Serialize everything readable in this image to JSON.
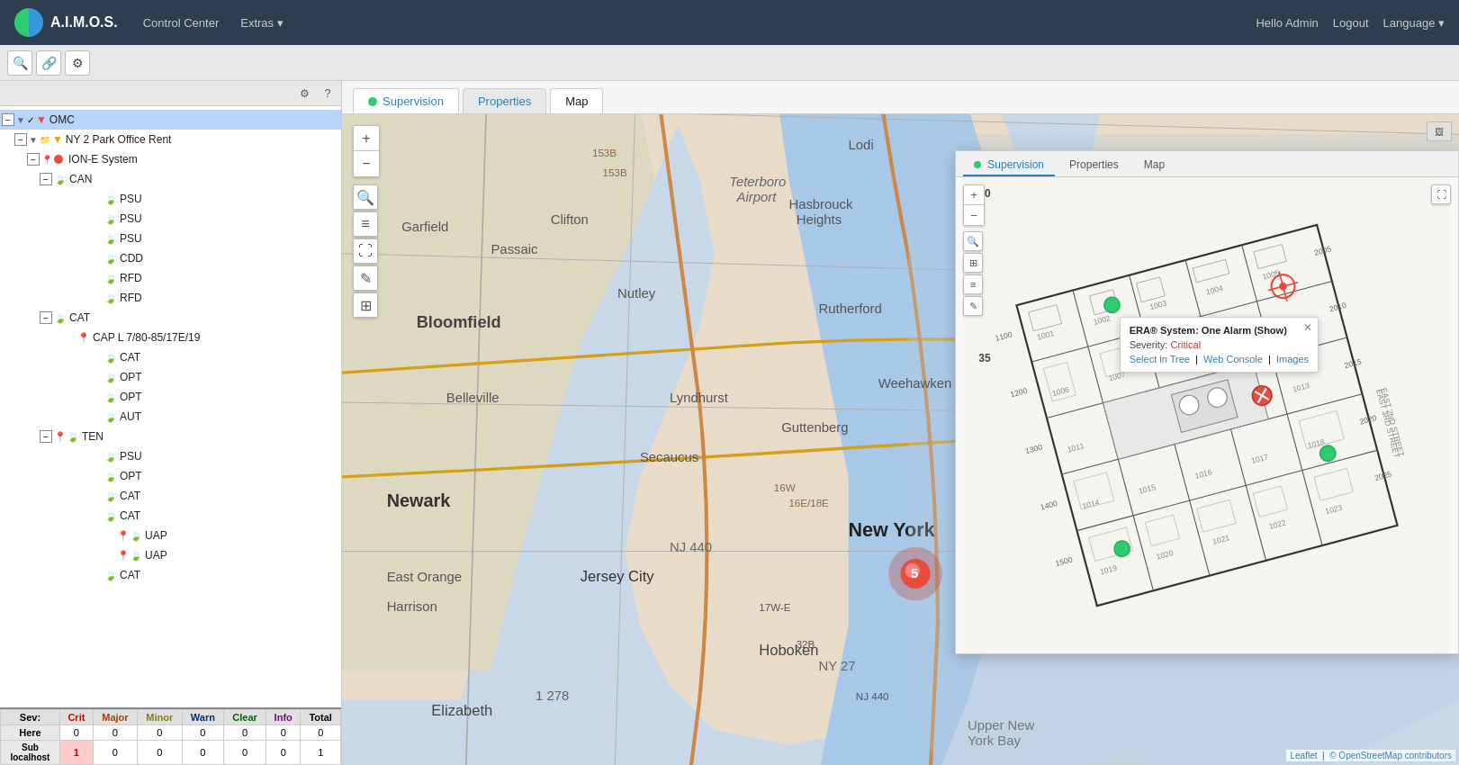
{
  "app": {
    "logo": "A.I.M.O.S.",
    "nav": {
      "control_center": "Control Center",
      "extras": "Extras ▾",
      "hello": "Hello Admin",
      "logout": "Logout",
      "language": "Language ▾"
    }
  },
  "toolbar": {
    "search_icon": "🔍",
    "link_icon": "🔗",
    "settings_icon": "⚙"
  },
  "tree": {
    "panel_buttons": [
      "⚙",
      "?"
    ],
    "items": [
      {
        "id": "omc",
        "label": "OMC",
        "level": 0,
        "expanded": true,
        "selected": false,
        "icon": "folder",
        "color": "red"
      },
      {
        "id": "ny2",
        "label": "NY 2 Park Office Rent",
        "level": 1,
        "expanded": true,
        "icon": "folder",
        "color": "yellow"
      },
      {
        "id": "ione",
        "label": "ION-E System",
        "level": 2,
        "expanded": true,
        "icon": "dot-red"
      },
      {
        "id": "can",
        "label": "CAN",
        "level": 3,
        "expanded": true,
        "icon": "leaf"
      },
      {
        "id": "psu1",
        "label": "PSU",
        "level": 4,
        "icon": "leaf"
      },
      {
        "id": "psu2",
        "label": "PSU",
        "level": 4,
        "icon": "leaf"
      },
      {
        "id": "psu3",
        "label": "PSU",
        "level": 4,
        "icon": "leaf"
      },
      {
        "id": "cdd",
        "label": "CDD",
        "level": 4,
        "icon": "leaf"
      },
      {
        "id": "rfd1",
        "label": "RFD",
        "level": 4,
        "icon": "leaf"
      },
      {
        "id": "rfd2",
        "label": "RFD",
        "level": 4,
        "icon": "leaf"
      },
      {
        "id": "cat1",
        "label": "CAT",
        "level": 3,
        "expanded": true,
        "icon": "leaf"
      },
      {
        "id": "capl",
        "label": "CAP L 7/80-85/17E/19",
        "level": 4,
        "icon": "location"
      },
      {
        "id": "cat2",
        "label": "CAT",
        "level": 4,
        "icon": "leaf"
      },
      {
        "id": "opt1",
        "label": "OPT",
        "level": 4,
        "icon": "leaf"
      },
      {
        "id": "opt2",
        "label": "OPT",
        "level": 4,
        "icon": "leaf"
      },
      {
        "id": "aut",
        "label": "AUT",
        "level": 4,
        "icon": "leaf"
      },
      {
        "id": "ten",
        "label": "TEN",
        "level": 3,
        "expanded": true,
        "icon": "leaf"
      },
      {
        "id": "psu4",
        "label": "PSU",
        "level": 4,
        "icon": "leaf"
      },
      {
        "id": "opt3",
        "label": "OPT",
        "level": 4,
        "icon": "leaf"
      },
      {
        "id": "cat3",
        "label": "CAT",
        "level": 4,
        "icon": "leaf"
      },
      {
        "id": "cat4",
        "label": "CAT",
        "level": 4,
        "icon": "leaf"
      },
      {
        "id": "uap1",
        "label": "UAP",
        "level": 5,
        "icon": "location"
      },
      {
        "id": "uap2",
        "label": "UAP",
        "level": 5,
        "icon": "location"
      },
      {
        "id": "cat5",
        "label": "CAT",
        "level": 4,
        "icon": "leaf"
      }
    ]
  },
  "tabs": {
    "supervision": "Supervision",
    "properties": "Properties",
    "map": "Map"
  },
  "map": {
    "attribution_leaflet": "Leaflet",
    "attribution_osm": "© OpenStreetMap contributors"
  },
  "floorplan": {
    "tabs": {
      "supervision": "Supervision",
      "properties": "Properties",
      "map": "Map"
    },
    "alarm": {
      "title": "ERA® System: One Alarm (Show)",
      "severity_label": "Severity:",
      "severity": "Critical",
      "links": [
        "Select in Tree",
        "Web Console",
        "Images"
      ]
    }
  },
  "status_table": {
    "headers": [
      "Sev:",
      "Crit",
      "Major",
      "Minor",
      "Warn",
      "Clear",
      "Info",
      "Total"
    ],
    "rows": [
      {
        "label": "Here",
        "crit": "0",
        "major": "0",
        "minor": "0",
        "warn": "0",
        "clear": "0",
        "info": "0",
        "total": "0"
      },
      {
        "label": "Sub\nlocalhost",
        "crit": "1",
        "major": "0",
        "minor": "0",
        "warn": "0",
        "clear": "0",
        "info": "0",
        "total": "1"
      }
    ]
  }
}
